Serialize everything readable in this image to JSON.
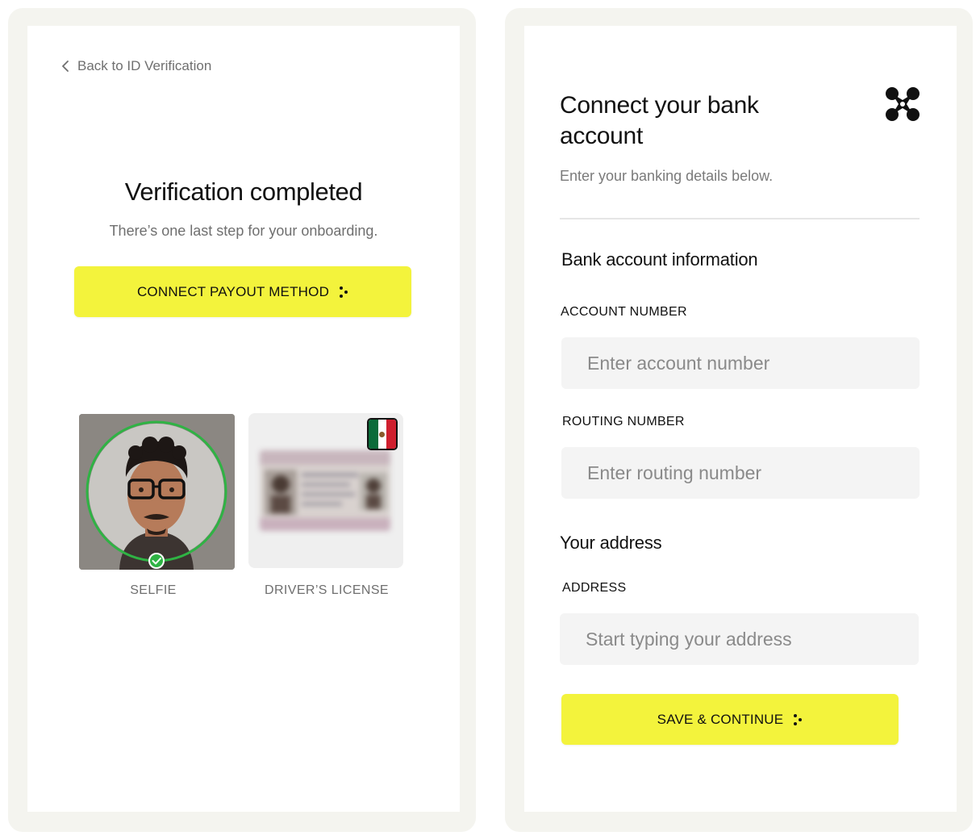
{
  "left_panel": {
    "back_link": "Back to ID Verification",
    "title": "Verification completed",
    "subtitle": "There’s one last step for your onboarding.",
    "connect_button": "CONNECT PAYOUT METHOD",
    "documents": [
      {
        "label": "SELFIE",
        "status": "verified"
      },
      {
        "label": "DRIVER’S LICENSE",
        "country_flag": "mexico-flag-icon"
      }
    ]
  },
  "right_panel": {
    "title": "Connect your bank account",
    "subtitle": "Enter your banking details below.",
    "bank_section": {
      "title": "Bank account information",
      "account_label": "ACCOUNT NUMBER",
      "account_placeholder": "Enter account number",
      "routing_label": "ROUTING NUMBER",
      "routing_placeholder": "Enter routing number"
    },
    "address_section": {
      "title": "Your address",
      "address_label": "ADDRESS",
      "address_placeholder": "Start typing your address"
    },
    "save_button": "SAVE & CONTINUE"
  },
  "colors": {
    "accent_yellow": "#f3f33c",
    "frame_bg": "#f4f4ef",
    "verified_green": "#2fb344",
    "muted_text": "#6f6f6f"
  }
}
